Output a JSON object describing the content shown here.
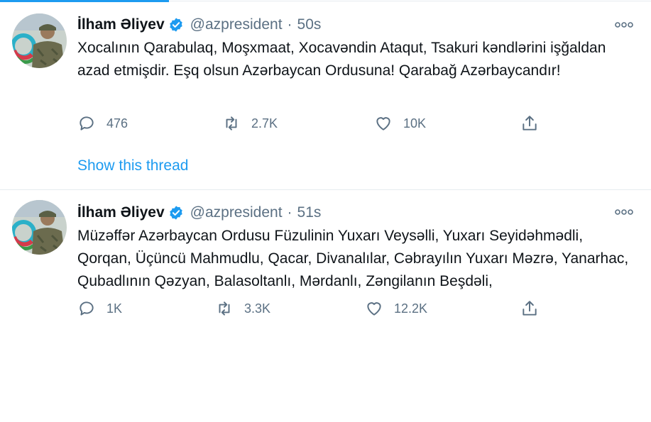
{
  "tweets": [
    {
      "author": "İlham Əliyev",
      "handle": "@azpresident",
      "separator": "·",
      "time": "50s",
      "text": "Xocalının Qarabulaq, Moşxmaat, Xocavəndin Ataqut, Tsakuri kəndlərini işğaldan azad etmişdir. Eşq olsun Azərbaycan Ordusuna! Qarabağ Azərbaycandır!",
      "replies": "476",
      "retweets": "2.7K",
      "likes": "10K",
      "show_thread": "Show this thread"
    },
    {
      "author": "İlham Əliyev",
      "handle": "@azpresident",
      "separator": "·",
      "time": "51s",
      "text": "Müzəffər Azərbaycan Ordusu Füzulinin Yuxarı Veysəlli, Yuxarı Seyidəhmədli, Qorqan, Üçüncü Mahmudlu, Qacar, Divanalılar, Cəbrayılın Yuxarı Məzrə, Yanarhac, Qubadlının Qəzyan, Balasoltanlı, Mərdanlı, Zəngilanın Beşdəli,",
      "replies": "1K",
      "retweets": "3.3K",
      "likes": "12.2K"
    }
  ],
  "icons": {
    "verified": "verified-badge-icon",
    "more": "more-dots-icon",
    "reply": "reply-icon",
    "retweet": "retweet-icon",
    "like": "heart-icon",
    "share": "share-icon"
  },
  "colors": {
    "accent": "#1d9bf0",
    "secondary_text": "#5b7083",
    "primary_text": "#0f1419",
    "divider": "#e6ecf0"
  }
}
